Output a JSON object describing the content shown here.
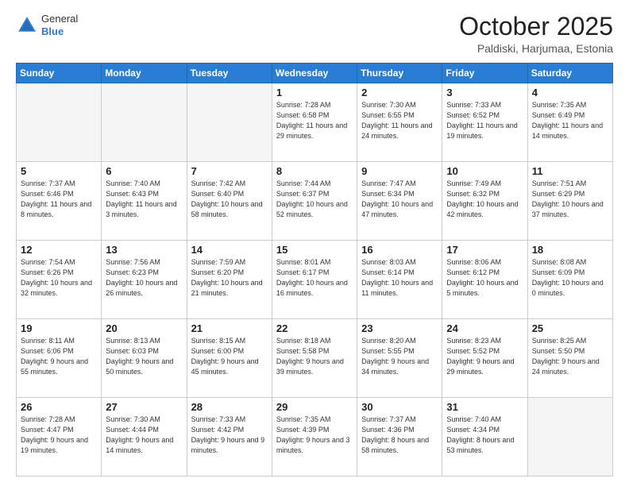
{
  "logo": {
    "line1": "General",
    "line2": "Blue"
  },
  "header": {
    "month": "October 2025",
    "location": "Paldiski, Harjumaa, Estonia"
  },
  "weekdays": [
    "Sunday",
    "Monday",
    "Tuesday",
    "Wednesday",
    "Thursday",
    "Friday",
    "Saturday"
  ],
  "weeks": [
    [
      {
        "day": "",
        "info": ""
      },
      {
        "day": "",
        "info": ""
      },
      {
        "day": "",
        "info": ""
      },
      {
        "day": "1",
        "info": "Sunrise: 7:28 AM\nSunset: 6:58 PM\nDaylight: 11 hours\nand 29 minutes."
      },
      {
        "day": "2",
        "info": "Sunrise: 7:30 AM\nSunset: 6:55 PM\nDaylight: 11 hours\nand 24 minutes."
      },
      {
        "day": "3",
        "info": "Sunrise: 7:33 AM\nSunset: 6:52 PM\nDaylight: 11 hours\nand 19 minutes."
      },
      {
        "day": "4",
        "info": "Sunrise: 7:35 AM\nSunset: 6:49 PM\nDaylight: 11 hours\nand 14 minutes."
      }
    ],
    [
      {
        "day": "5",
        "info": "Sunrise: 7:37 AM\nSunset: 6:46 PM\nDaylight: 11 hours\nand 8 minutes."
      },
      {
        "day": "6",
        "info": "Sunrise: 7:40 AM\nSunset: 6:43 PM\nDaylight: 11 hours\nand 3 minutes."
      },
      {
        "day": "7",
        "info": "Sunrise: 7:42 AM\nSunset: 6:40 PM\nDaylight: 10 hours\nand 58 minutes."
      },
      {
        "day": "8",
        "info": "Sunrise: 7:44 AM\nSunset: 6:37 PM\nDaylight: 10 hours\nand 52 minutes."
      },
      {
        "day": "9",
        "info": "Sunrise: 7:47 AM\nSunset: 6:34 PM\nDaylight: 10 hours\nand 47 minutes."
      },
      {
        "day": "10",
        "info": "Sunrise: 7:49 AM\nSunset: 6:32 PM\nDaylight: 10 hours\nand 42 minutes."
      },
      {
        "day": "11",
        "info": "Sunrise: 7:51 AM\nSunset: 6:29 PM\nDaylight: 10 hours\nand 37 minutes."
      }
    ],
    [
      {
        "day": "12",
        "info": "Sunrise: 7:54 AM\nSunset: 6:26 PM\nDaylight: 10 hours\nand 32 minutes."
      },
      {
        "day": "13",
        "info": "Sunrise: 7:56 AM\nSunset: 6:23 PM\nDaylight: 10 hours\nand 26 minutes."
      },
      {
        "day": "14",
        "info": "Sunrise: 7:59 AM\nSunset: 6:20 PM\nDaylight: 10 hours\nand 21 minutes."
      },
      {
        "day": "15",
        "info": "Sunrise: 8:01 AM\nSunset: 6:17 PM\nDaylight: 10 hours\nand 16 minutes."
      },
      {
        "day": "16",
        "info": "Sunrise: 8:03 AM\nSunset: 6:14 PM\nDaylight: 10 hours\nand 11 minutes."
      },
      {
        "day": "17",
        "info": "Sunrise: 8:06 AM\nSunset: 6:12 PM\nDaylight: 10 hours\nand 5 minutes."
      },
      {
        "day": "18",
        "info": "Sunrise: 8:08 AM\nSunset: 6:09 PM\nDaylight: 10 hours\nand 0 minutes."
      }
    ],
    [
      {
        "day": "19",
        "info": "Sunrise: 8:11 AM\nSunset: 6:06 PM\nDaylight: 9 hours\nand 55 minutes."
      },
      {
        "day": "20",
        "info": "Sunrise: 8:13 AM\nSunset: 6:03 PM\nDaylight: 9 hours\nand 50 minutes."
      },
      {
        "day": "21",
        "info": "Sunrise: 8:15 AM\nSunset: 6:00 PM\nDaylight: 9 hours\nand 45 minutes."
      },
      {
        "day": "22",
        "info": "Sunrise: 8:18 AM\nSunset: 5:58 PM\nDaylight: 9 hours\nand 39 minutes."
      },
      {
        "day": "23",
        "info": "Sunrise: 8:20 AM\nSunset: 5:55 PM\nDaylight: 9 hours\nand 34 minutes."
      },
      {
        "day": "24",
        "info": "Sunrise: 8:23 AM\nSunset: 5:52 PM\nDaylight: 9 hours\nand 29 minutes."
      },
      {
        "day": "25",
        "info": "Sunrise: 8:25 AM\nSunset: 5:50 PM\nDaylight: 9 hours\nand 24 minutes."
      }
    ],
    [
      {
        "day": "26",
        "info": "Sunrise: 7:28 AM\nSunset: 4:47 PM\nDaylight: 9 hours\nand 19 minutes."
      },
      {
        "day": "27",
        "info": "Sunrise: 7:30 AM\nSunset: 4:44 PM\nDaylight: 9 hours\nand 14 minutes."
      },
      {
        "day": "28",
        "info": "Sunrise: 7:33 AM\nSunset: 4:42 PM\nDaylight: 9 hours\nand 9 minutes."
      },
      {
        "day": "29",
        "info": "Sunrise: 7:35 AM\nSunset: 4:39 PM\nDaylight: 9 hours\nand 3 minutes."
      },
      {
        "day": "30",
        "info": "Sunrise: 7:37 AM\nSunset: 4:36 PM\nDaylight: 8 hours\nand 58 minutes."
      },
      {
        "day": "31",
        "info": "Sunrise: 7:40 AM\nSunset: 4:34 PM\nDaylight: 8 hours\nand 53 minutes."
      },
      {
        "day": "",
        "info": ""
      }
    ]
  ]
}
